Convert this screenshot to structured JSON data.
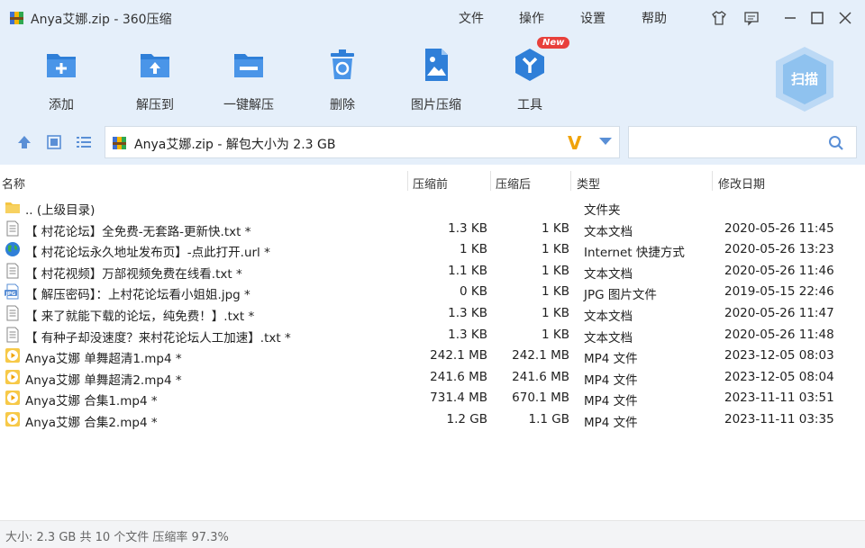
{
  "window": {
    "title": "Anya艾娜.zip - 360压缩",
    "menu": [
      "文件",
      "操作",
      "设置",
      "帮助"
    ],
    "controls": [
      "skin-icon",
      "feedback-icon",
      "minimize-icon",
      "maximize-icon",
      "close-icon"
    ]
  },
  "toolbar": {
    "items": [
      {
        "label": "添加",
        "icon": "add-icon"
      },
      {
        "label": "解压到",
        "icon": "extract-to-icon"
      },
      {
        "label": "一键解压",
        "icon": "one-click-extract-icon"
      },
      {
        "label": "删除",
        "icon": "delete-icon"
      },
      {
        "label": "图片压缩",
        "icon": "image-compress-icon"
      },
      {
        "label": "工具",
        "icon": "tools-icon",
        "badge": "New"
      }
    ],
    "scan_label": "扫描"
  },
  "navbar": {
    "path": "Anya艾娜.zip - 解包大小为 2.3 GB",
    "verify_mark": "V",
    "search": {
      "value": "",
      "placeholder": ""
    }
  },
  "columns": {
    "name": "名称",
    "before": "压缩前",
    "after": "压缩后",
    "type": "类型",
    "modified": "修改日期"
  },
  "files": [
    {
      "name": ".. (上级目录)",
      "before": "",
      "after": "",
      "type": "文件夹",
      "date": "",
      "icon": "folder-icon"
    },
    {
      "name": "【 村花论坛】全免费-无套路-更新快.txt *",
      "before": "1.3 KB",
      "after": "1 KB",
      "type": "文本文档",
      "date": "2020-05-26 11:45",
      "icon": "text-file-icon"
    },
    {
      "name": "【 村花论坛永久地址发布页】-点此打开.url *",
      "before": "1 KB",
      "after": "1 KB",
      "type": "Internet 快捷方式",
      "date": "2020-05-26 13:23",
      "icon": "globe-icon"
    },
    {
      "name": "【 村花视频】万部视频免费在线看.txt *",
      "before": "1.1 KB",
      "after": "1 KB",
      "type": "文本文档",
      "date": "2020-05-26 11:46",
      "icon": "text-file-icon"
    },
    {
      "name": "【 解压密码】：上村花论坛看小姐姐.jpg *",
      "before": "0 KB",
      "after": "1 KB",
      "type": "JPG 图片文件",
      "date": "2019-05-15 22:46",
      "icon": "jpg-file-icon"
    },
    {
      "name": "【 来了就能下载的论坛，纯免费！】.txt *",
      "before": "1.3 KB",
      "after": "1 KB",
      "type": "文本文档",
      "date": "2020-05-26 11:47",
      "icon": "text-file-icon"
    },
    {
      "name": "【 有种子却没速度？来村花论坛人工加速】.txt *",
      "before": "1.3 KB",
      "after": "1 KB",
      "type": "文本文档",
      "date": "2020-05-26 11:48",
      "icon": "text-file-icon"
    },
    {
      "name": "Anya艾娜 单舞超清1.mp4 *",
      "before": "242.1 MB",
      "after": "242.1 MB",
      "type": "MP4 文件",
      "date": "2023-12-05 08:03",
      "icon": "video-file-icon"
    },
    {
      "name": "Anya艾娜 单舞超清2.mp4 *",
      "before": "241.6 MB",
      "after": "241.6 MB",
      "type": "MP4 文件",
      "date": "2023-12-05 08:04",
      "icon": "video-file-icon"
    },
    {
      "name": "Anya艾娜 合集1.mp4 *",
      "before": "731.4 MB",
      "after": "670.1 MB",
      "type": "MP4 文件",
      "date": "2023-11-11 03:51",
      "icon": "video-file-icon"
    },
    {
      "name": "Anya艾娜 合集2.mp4 *",
      "before": "1.2 GB",
      "after": "1.1 GB",
      "type": "MP4 文件",
      "date": "2023-11-11 03:35",
      "icon": "video-file-icon"
    }
  ],
  "status": {
    "text": "大小: 2.3 GB 共 10 个文件 压缩率 97.3%"
  },
  "colors": {
    "header_bg": "#e5effa",
    "accent": "#2f7fd8",
    "badge": "#e8403b",
    "verify": "#f0a30a"
  }
}
